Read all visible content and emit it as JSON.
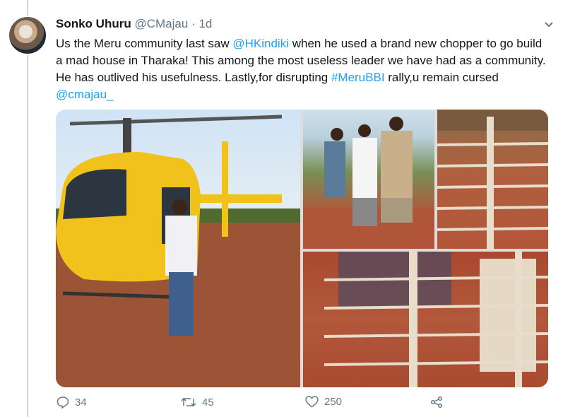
{
  "tweet": {
    "display_name": "Sonko Uhuru",
    "handle": "@CMajau",
    "separator": "·",
    "time": "1d",
    "text": {
      "part1": "Us the Meru community last saw ",
      "mention1": "@HKindiki",
      "part2": " when he used a brand new chopper to go build a mad house in Tharaka! This among the most useless leader we have had as a community. He has outlived his usefulness. Lastly,for disrupting ",
      "hashtag": "#MeruBBI",
      "part3": " rally,u remain cursed ",
      "mention2": "@cmajau_"
    }
  },
  "actions": {
    "reply_count": "34",
    "retweet_count": "45",
    "like_count": "250"
  },
  "icons": {
    "avatar": "avatar-image",
    "caret": "chevron-down-icon",
    "reply": "reply-icon",
    "retweet": "retweet-icon",
    "like": "heart-icon",
    "share": "share-icon"
  },
  "colors": {
    "link": "#1da1f2",
    "secondary_text": "#657786",
    "primary_text": "#14171a",
    "thread_line": "#ccd6dd"
  }
}
